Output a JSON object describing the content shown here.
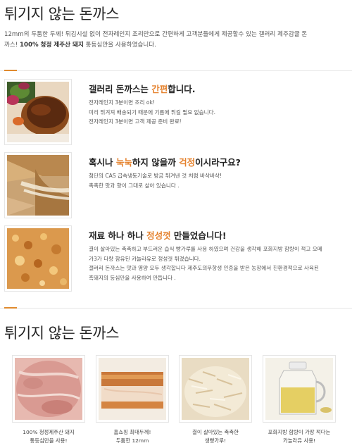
{
  "header": {
    "title": "튀기지 않는 돈까스",
    "intro_line1": "12mm의 두툼한 두께! 튀김시설 없이 전자레인지 조리만으로 간편하게 고객분들에게 제공할수 있는 갤러리 제주감귤 돈",
    "intro_line2_pre": "까스! ",
    "intro_line2_bold": "100% 청정 제주산 돼지",
    "intro_line2_post": " 통등심만을 사용하였습니다."
  },
  "features": [
    {
      "title_pre": "갤러리 돈까스는 ",
      "title_hl": "간편",
      "title_post": "합니다.",
      "lines": [
        "전자레인지 3분이면 조리 ok!",
        "미리 튀겨져 배송되기 때문에 기름에 튀길 필요 없습니다.",
        "전자레인지 3분이면 고객 제공 준비 완료!"
      ],
      "image": "cutlet-with-salad"
    },
    {
      "title_pre": "혹시나 ",
      "title_hl": "눅눅",
      "title_mid": "하지 않을까 ",
      "title_hl2": "걱정",
      "title_post": "이시라구요?",
      "lines": [
        "첨단의 CAS 급속냉동기술로 방금 튀겨낸 것 처럼 바삭바삭!",
        "촉촉한 맛과 향이 그대로 살아 있습니다 ."
      ],
      "image": "cutlet-cheese-pull"
    },
    {
      "title_pre": "재료 하나 하나 ",
      "title_hl": "정성껏",
      "title_post": " 만들었습니다!",
      "lines": [
        "결이 살아있는 촉촉하고 부드러운 습식 빵가루를 사용 하였으며 건강을 생각해 포화지방 함량이 적고 오메",
        "가3가 다량 함유된 카놀라유로 정성껏 튀겼습니다.",
        "갤러리 돈까스는 맛과 영양 모두 생각합니다 제주도의무항생 인증을 받은 농장에서 친환경적으로 사육된",
        "흑돼지의 등심만을 사용하여 만듭니다 ."
      ],
      "image": "cutlet-crispy-closeup"
    }
  ],
  "section2": {
    "title": "튀기지 않는 돈까스"
  },
  "products": [
    {
      "line1": "100% 청정제주산 돼지",
      "line2": "통등심만을 사용!",
      "image": "raw-pork-loin"
    },
    {
      "line1": "홈쇼핑 최대두께!",
      "line2": "두툼한 12mm",
      "image": "thick-cutlet-slice"
    },
    {
      "line1": "결이 살아있는 촉촉한",
      "line2": "생빵가루!",
      "image": "wet-breadcrumbs"
    },
    {
      "line1": "포화지방 함량이 가장 적다는",
      "line2": "카놀라유 사용!",
      "image": "canola-oil-jug"
    }
  ],
  "colors": {
    "accent": "#e5822e",
    "divider": "#e6e6e6"
  }
}
